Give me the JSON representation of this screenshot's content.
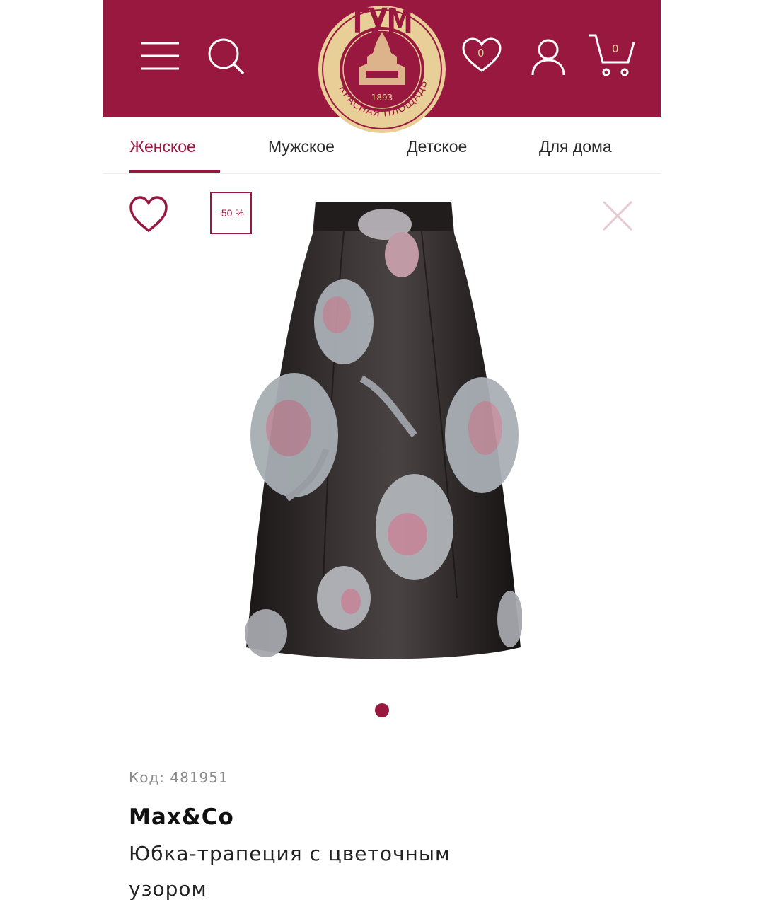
{
  "header": {
    "logo_title": "ГУМ",
    "logo_year": "1893",
    "logo_ring_text": "КРАСНАЯ ПЛОЩАДЬ",
    "favorites_count": "0",
    "cart_count": "0",
    "icons": [
      "menu-icon",
      "search-icon",
      "heart-icon",
      "user-icon",
      "cart-icon"
    ]
  },
  "nav": {
    "tabs": [
      {
        "label": "Женское",
        "active": true
      },
      {
        "label": "Мужское",
        "active": false
      },
      {
        "label": "Детское",
        "active": false
      },
      {
        "label": "Для дома",
        "active": false
      }
    ]
  },
  "product": {
    "discount": "-50 %",
    "image_count": 1,
    "active_image": 1,
    "code_label": "Код:",
    "code": "481951",
    "brand": "Max&Co",
    "name": "Юбка-трапеция с цветочным узором"
  },
  "colors": {
    "brand": "#99183f",
    "gold": "#e8cf98",
    "close": "#e7c9d2"
  }
}
